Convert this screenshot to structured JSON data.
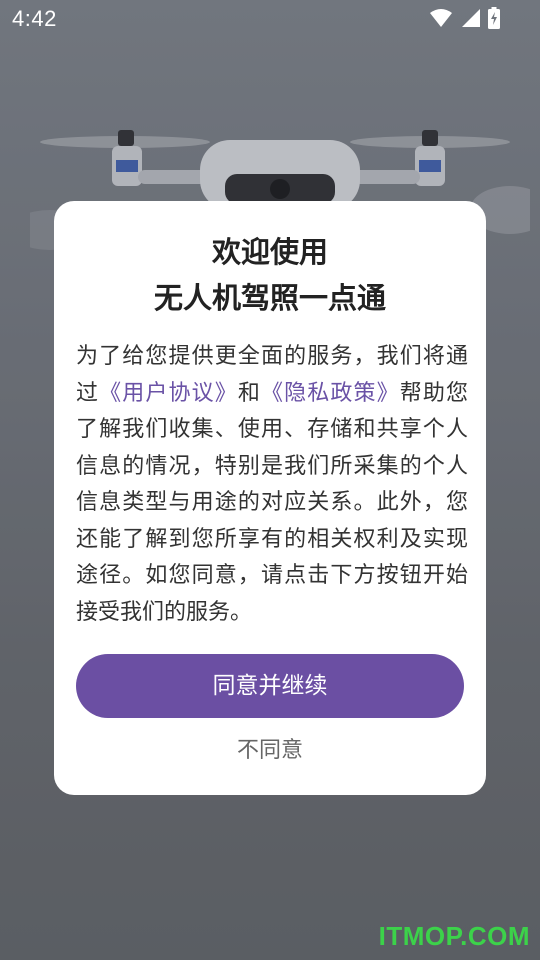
{
  "status_bar": {
    "time": "4:42",
    "icons": [
      "wifi-icon",
      "cellular-signal-icon",
      "battery-charging-icon"
    ]
  },
  "dialog": {
    "title_line1": "欢迎使用",
    "title_line2": "无人机驾照一点通",
    "body": {
      "part1": "为了给您提供更全面的服务，我们将通过",
      "user_agreement_link": "《用户协议》",
      "part2": "和",
      "privacy_policy_link": "《隐私政策》",
      "part3": "帮助您了解我们收集、使用、存储和共享个人信息的情况，特别是我们所采集的个人信息类型与用途的对应关系。此外，您还能了解到您所享有的相关权利及实现途径。如您同意，请点击下方按钮开始接受我们的服务。"
    },
    "agree_button": "同意并继续",
    "disagree_button": "不同意"
  },
  "watermark": "ITMOP.COM",
  "colors": {
    "accent": "#6b4fa3",
    "link": "#6a52a6",
    "watermark": "#3cd24a"
  }
}
